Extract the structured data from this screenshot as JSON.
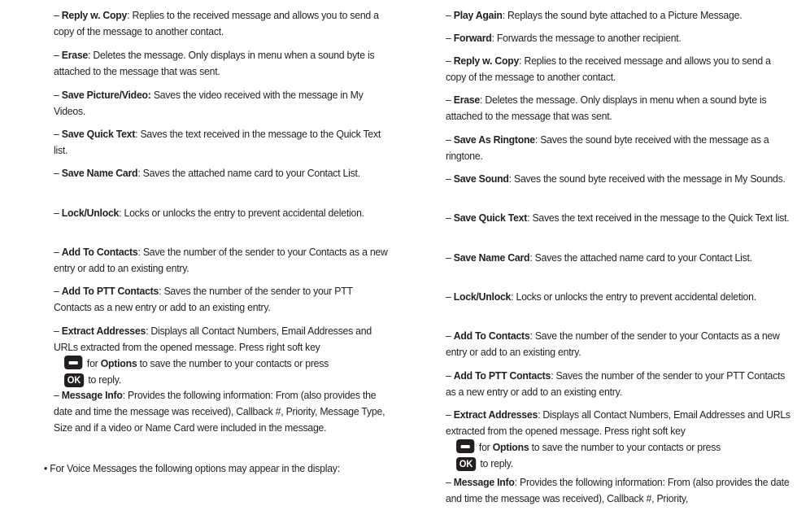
{
  "left": {
    "items": [
      {
        "label": "Reply w. Copy",
        "sep": ": ",
        "text": "Replies to the received message and allows you to send a copy of the message to another contact."
      },
      {
        "label": "Erase",
        "sep": ": ",
        "text": "Deletes the message. Only displays in menu when a sound byte is attached to the message that was sent."
      },
      {
        "label": "Save Picture/Video:",
        "sep": " ",
        "text": "Saves the video received with the message in My Videos."
      },
      {
        "label": "Save Quick Text",
        "sep": ": ",
        "text": "Saves the text received in the message to the Quick Text list."
      },
      {
        "label": "Save Name Card",
        "sep": ": ",
        "text": "Saves the attached name card to your Contact List."
      },
      {
        "label": "Lock/Unlock",
        "sep": ": ",
        "text": "Locks or unlocks the entry to prevent accidental deletion."
      },
      {
        "label": "Add To Contacts",
        "sep": ": ",
        "text": "Save the number of the sender to your Contacts as a new entry or add to an existing entry."
      },
      {
        "label": "Add To PTT Contacts",
        "sep": ": ",
        "text": "Saves the number of the sender to your PTT Contacts as a new entry or add to an existing entry."
      }
    ],
    "extract": {
      "label": "Extract Addresses",
      "text1": ": Displays all Contact Numbers, Email Addresses and URLs extracted from the opened message. Press right soft key",
      "for_text": "for",
      "options_label": "Options",
      "text2": "to save the number to your contacts or press",
      "ok_key": "OK",
      "text3": "to reply."
    },
    "info": {
      "label": "Message Info",
      "text": ": Provides the following information: From (also provides the date and time the message was received), Callback #, Priority, Message Type, Size and if a video or Name Card were included in the message."
    },
    "bullet": "For Voice Messages the following options may appear in the display:"
  },
  "right": {
    "items": [
      {
        "label": "Play Again",
        "sep": ": ",
        "text": "Replays the sound byte attached to a Picture Message."
      },
      {
        "label": "Forward",
        "sep": ": ",
        "text": "Forwards the message to another recipient."
      },
      {
        "label": "Reply w. Copy",
        "sep": ": ",
        "text": "Replies to the received message and allows you to send a copy of the message to another contact."
      },
      {
        "label": "Erase",
        "sep": ": ",
        "text": "Deletes the message. Only displays in menu when a sound byte is attached to the message that was sent."
      },
      {
        "label": "Save As Ringtone",
        "sep": ": ",
        "text": "Saves the sound byte received with the message as a ringtone."
      },
      {
        "label": "Save Sound",
        "sep": ": ",
        "text": "Saves the sound byte received with the message in My Sounds."
      },
      {
        "label": "Save Quick Text",
        "sep": ": ",
        "text": "Saves the text received in the message to the Quick Text list."
      },
      {
        "label": "Save Name Card",
        "sep": ": ",
        "text": "Saves the attached name card to your Contact List."
      },
      {
        "label": "Lock/Unlock",
        "sep": ": ",
        "text": "Locks or unlocks the entry to prevent accidental deletion."
      },
      {
        "label": "Add To Contacts",
        "sep": ": ",
        "text": "Save the number of the sender to your Contacts as a new entry or add to an existing entry."
      },
      {
        "label": "Add To PTT Contacts",
        "sep": ": ",
        "text": "Saves the number of the sender to your PTT Contacts as a new entry or add to an existing entry."
      }
    ],
    "extract": {
      "label": "Extract Addresses",
      "text1": ": Displays all Contact Numbers, Email Addresses and URLs extracted from the opened message. Press right soft key",
      "for_text": "for",
      "options_label": "Options",
      "text2": "to save the number to your contacts or press",
      "ok_key": "OK",
      "text3": "to reply."
    },
    "info": {
      "label": "Message Info",
      "text": ": Provides the following information: From (also provides the date and time the message was received), Callback #, Priority,"
    }
  }
}
